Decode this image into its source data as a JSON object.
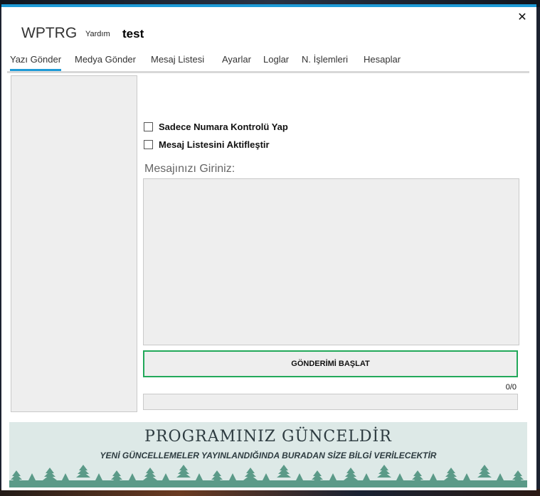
{
  "app": {
    "title": "WPTRG",
    "help_label": "Yardım",
    "user_name": "test"
  },
  "window": {
    "close_glyph": "✕",
    "accent_color": "#1e9bd7"
  },
  "tabs": [
    {
      "label": "Yazı Gönder",
      "active": true
    },
    {
      "label": "Medya Gönder",
      "active": false
    },
    {
      "label": "Mesaj Listesi",
      "active": false
    },
    {
      "label": "Ayarlar",
      "active": false
    },
    {
      "label": "Loglar",
      "active": false
    },
    {
      "label": "N. İşlemleri",
      "active": false
    },
    {
      "label": "Hesaplar",
      "active": false
    }
  ],
  "options": {
    "number_check": {
      "label": "Sadece Numara Kontrolü Yap",
      "checked": false
    },
    "message_list": {
      "label": "Mesaj Listesini Aktifleştir",
      "checked": false
    }
  },
  "message": {
    "label": "Mesajınızı Giriniz:",
    "value": ""
  },
  "send": {
    "button_label": "GÖNDERİMİ BAŞLAT",
    "button_border_color": "#22a85a",
    "counter": "0/0",
    "progress": 0
  },
  "banner": {
    "title": "PROGRAMINIZ GÜNCELDİR",
    "subtitle": "YENİ GÜNCELLEMELER YAYINLANDIĞINDA BURADAN SİZE BİLGİ VERİLECEKTİR",
    "background_color": "#dde9e7",
    "tree_color": "#5b9a88"
  }
}
